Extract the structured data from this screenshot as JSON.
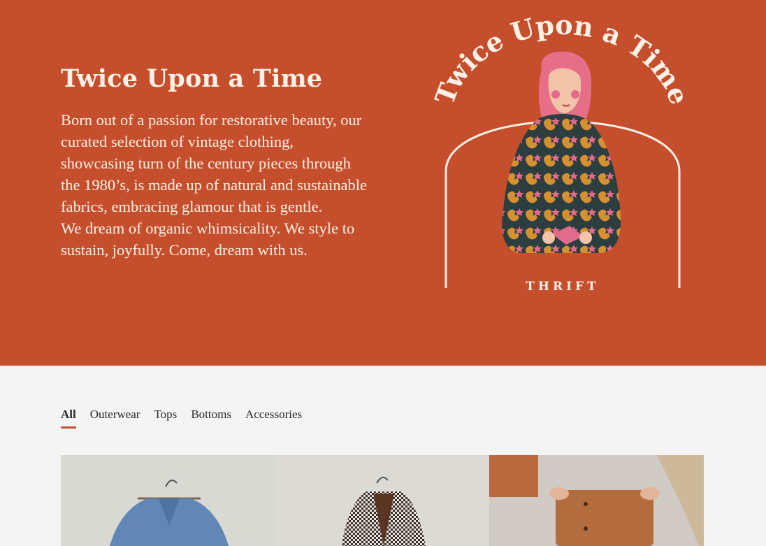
{
  "hero": {
    "title": "Twice Upon a Time",
    "paragraph1": "Born out of a passion for restorative beauty, our curated selection of vintage clothing, showcasing turn of the century pieces through the 1980’s, is made up of natural and sustainable fabrics, embracing glamour that is gentle.",
    "paragraph2": "We dream of organic whimsicality. We style to sustain, joyfully. Come, dream with us."
  },
  "logo": {
    "arc_text": "Twice Upon a Time",
    "subtitle": "THRIFT"
  },
  "tabs": [
    {
      "label": "All",
      "active": true
    },
    {
      "label": "Outerwear",
      "active": false
    },
    {
      "label": "Tops",
      "active": false
    },
    {
      "label": "Bottoms",
      "active": false
    },
    {
      "label": "Accessories",
      "active": false
    }
  ],
  "products": [
    {
      "name": "denim-jacket"
    },
    {
      "name": "houndstooth-coat"
    },
    {
      "name": "suede-skirt"
    }
  ],
  "colors": {
    "hero_bg": "#c54f2d",
    "hero_text": "#fbf1e6",
    "page_bg": "#f4f4f4",
    "accent": "#c54f2d"
  }
}
